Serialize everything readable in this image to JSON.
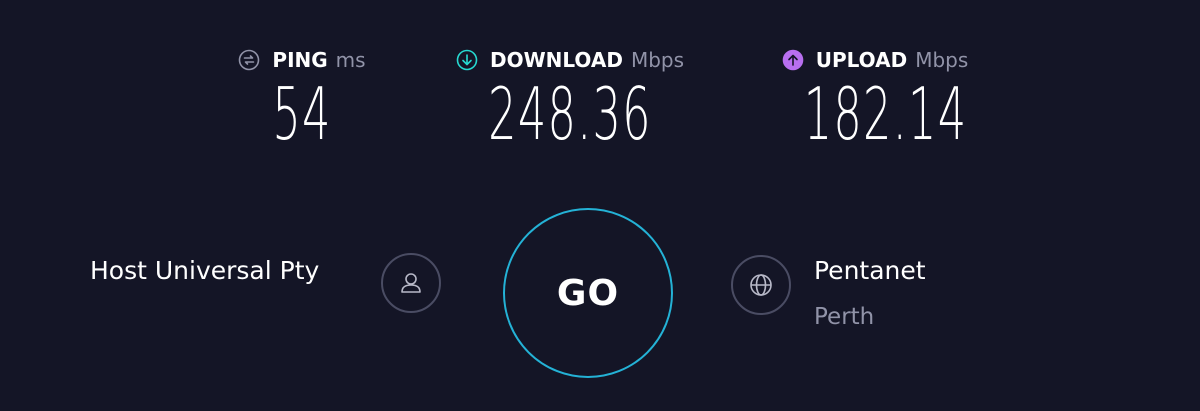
{
  "metrics": {
    "ping": {
      "label": "PING",
      "unit": "ms",
      "value": "54",
      "icon": "ping-icon",
      "color": "#9193a8"
    },
    "download": {
      "label": "DOWNLOAD",
      "unit": "Mbps",
      "value": "248.36",
      "icon": "download-icon",
      "color": "#26d9d1"
    },
    "upload": {
      "label": "UPLOAD",
      "unit": "Mbps",
      "value": "182.14",
      "icon": "upload-icon",
      "color": "#b86ff0"
    }
  },
  "isp": {
    "name": "Host Universal Pty",
    "icon": "user-icon"
  },
  "go_button": {
    "label": "GO",
    "ring_color": "#24b2d6"
  },
  "server": {
    "name": "Pentanet",
    "location": "Perth",
    "icon": "globe-icon"
  },
  "colors": {
    "background": "#141526",
    "muted": "#9193a8"
  }
}
